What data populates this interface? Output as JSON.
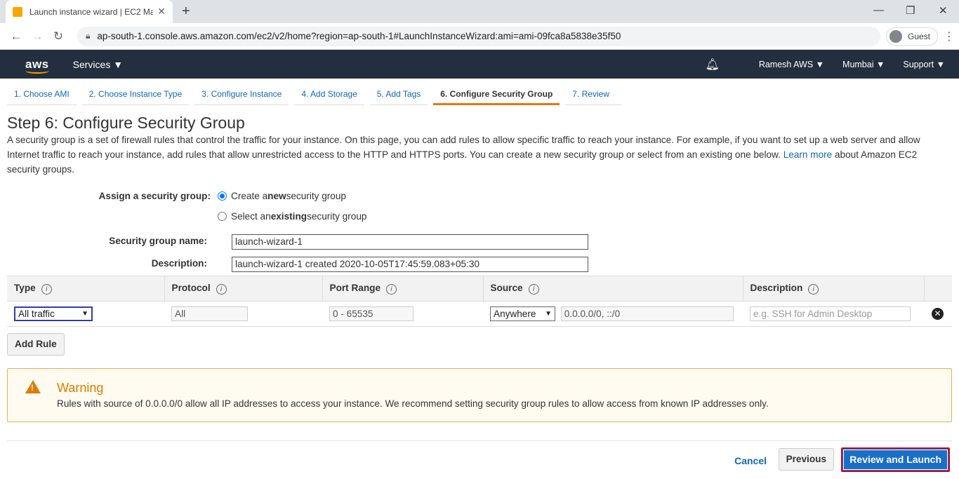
{
  "browser": {
    "tab_title": "Launch instance wizard | EC2 Ma",
    "url": "ap-south-1.console.aws.amazon.com/ec2/v2/home?region=ap-south-1#LaunchInstanceWizard:ami=ami-09fca8a5838e35f50",
    "profile": "Guest"
  },
  "nav": {
    "logo": "aws",
    "services": "Services",
    "user": "Ramesh AWS",
    "region": "Mumbai",
    "support": "Support"
  },
  "steps": [
    "1. Choose AMI",
    "2. Choose Instance Type",
    "3. Configure Instance",
    "4. Add Storage",
    "5. Add Tags",
    "6. Configure Security Group",
    "7. Review"
  ],
  "page": {
    "title": "Step 6: Configure Security Group",
    "intro_1": "A security group is a set of firewall rules that control the traffic for your instance. On this page, you can add rules to allow specific traffic to reach your instance. For example, if you want to set up a web server and allow Internet traffic to reach your instance, add rules that allow unrestricted access to the HTTP and HTTPS ports. You can create a new security group or select from an existing one below.",
    "learn_more": "Learn more",
    "intro_2": "about Amazon EC2 security groups."
  },
  "form": {
    "assign_label": "Assign a security group:",
    "option_create": {
      "pre": "Create a ",
      "bold": "new",
      "post": " security group"
    },
    "option_select": {
      "pre": "Select an ",
      "bold": "existing",
      "post": " security group"
    },
    "name_label": "Security group name:",
    "name_value": "launch-wizard-1",
    "desc_label": "Description:",
    "desc_value": "launch-wizard-1 created 2020-10-05T17:45:59.083+05:30"
  },
  "table": {
    "headers": [
      "Type",
      "Protocol",
      "Port Range",
      "Source",
      "Description"
    ],
    "row": {
      "type": "All traffic",
      "protocol": "All",
      "port_range": "0 - 65535",
      "source_select": "Anywhere",
      "source_cidr": "0.0.0.0/0, ::/0",
      "description_placeholder": "e.g. SSH for Admin Desktop"
    },
    "add_rule": "Add Rule"
  },
  "warning": {
    "title": "Warning",
    "text": "Rules with source of 0.0.0.0/0 allow all IP addresses to access your instance. We recommend setting security group rules to allow access from known IP addresses only."
  },
  "footer": {
    "cancel": "Cancel",
    "previous": "Previous",
    "review_launch": "Review and Launch"
  }
}
